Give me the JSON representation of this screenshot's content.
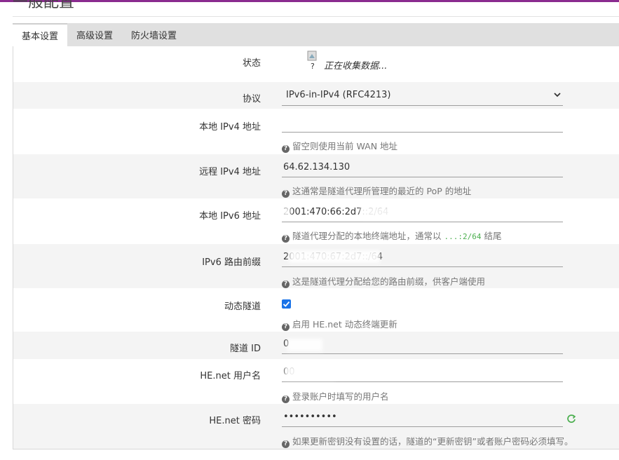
{
  "section": {
    "title": "一般配置"
  },
  "tabs": [
    {
      "label": "基本设置"
    },
    {
      "label": "高级设置"
    },
    {
      "label": "防火墙设置"
    }
  ],
  "form": {
    "status": {
      "label": "状态",
      "icon": "?",
      "text": "正在收集数据..."
    },
    "protocol": {
      "label": "协议",
      "value": "IPv6-in-IPv4 (RFC4213)"
    },
    "local_ipv4": {
      "label": "本地 IPv4 地址",
      "value": "",
      "help": "留空则使用当前 WAN 地址"
    },
    "remote_ipv4": {
      "label": "远程 IPv4 地址",
      "value": "64.62.134.130",
      "help": "这通常是隧道代理所管理的最近的 PoP 的地址"
    },
    "local_ipv6": {
      "label": "本地 IPv6 地址",
      "value": "2001:470:66:2d7::2/64",
      "help_prefix": "隧道代理分配的本地终端地址，通常以",
      "help_code": "...:2/64",
      "help_suffix": "结尾"
    },
    "routed_prefix": {
      "label": "IPv6 路由前缀",
      "value": "2001:470:67:2d7::/64",
      "help": "这是隧道代理分配给您的路由前缀，供客户端使用"
    },
    "dynamic_tunnel": {
      "label": "动态隧道",
      "checked": true,
      "help": "启用 HE.net 动态终端更新"
    },
    "tunnel_id": {
      "label": "隧道 ID",
      "value": "0"
    },
    "username": {
      "label": "HE.net 用户名",
      "value": "00",
      "help": "登录账户时填写的用户名"
    },
    "password": {
      "label": "HE.net 密码",
      "value": "••••••••••",
      "help": "如果更新密钥没有设置的话，隧道的“更新密钥”或者账户密码必须填写。"
    }
  },
  "colors": {
    "accent": "#8a2b8f",
    "checkbox": "#1a73e8",
    "tab_bar": "#e0e0e0",
    "alt_row": "#f4f4f4"
  },
  "icons": {
    "help": "question-circle-icon",
    "reveal": "refresh-eye-icon",
    "dropdown": "chevron-down-icon"
  }
}
